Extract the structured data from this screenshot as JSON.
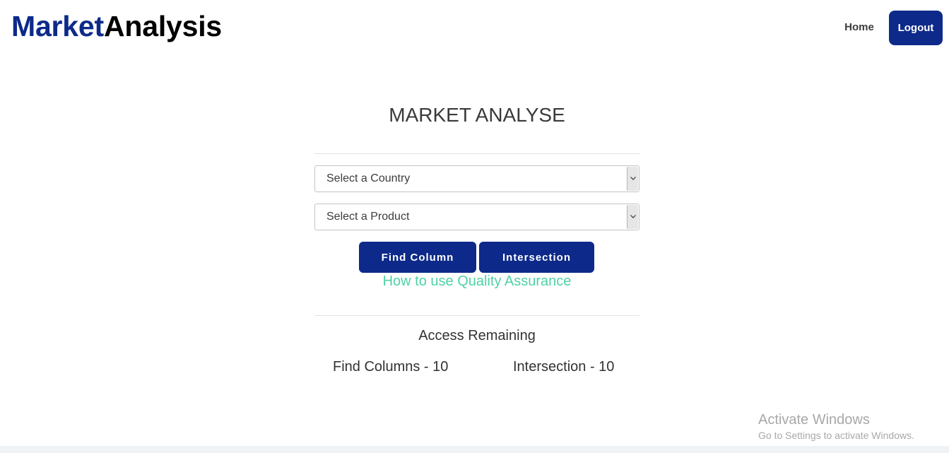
{
  "header": {
    "brand_part1": "Market",
    "brand_part2": "Analysis",
    "nav_home": "Home",
    "logout_label": "Logout"
  },
  "main": {
    "title": "MARKET ANALYSE",
    "country_select": {
      "selected": "Select a Country"
    },
    "product_select": {
      "selected": "Select a Product"
    },
    "find_column_label": "Find Column",
    "intersection_label": "Intersection",
    "help_link": "How to use Quality Assurance"
  },
  "access": {
    "title": "Access Remaining",
    "find_columns": "Find Columns - 10",
    "intersection": "Intersection - 10"
  },
  "os_watermark": {
    "title": "Activate Windows",
    "subtitle": "Go to Settings to activate Windows."
  },
  "colors": {
    "brand_blue": "#0d2a8a",
    "link_green": "#4fd1a5",
    "text": "#333333"
  }
}
